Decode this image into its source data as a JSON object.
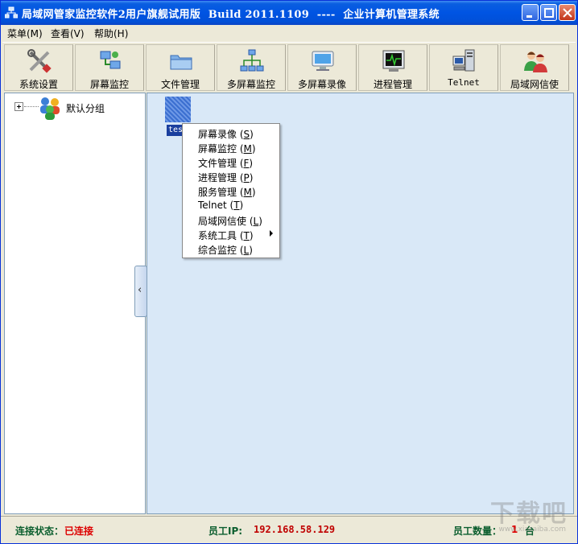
{
  "window": {
    "title": "局域网管家监控软件2用户旗舰试用版  Build 2011.1109  ----  企业计算机管理系统"
  },
  "menubar": {
    "items": [
      "菜单(M)",
      "查看(V)",
      "帮助(H)"
    ]
  },
  "toolbar": {
    "buttons": [
      {
        "label": "系统设置",
        "icon": "tools-icon"
      },
      {
        "label": "屏幕监控",
        "icon": "network-monitor-icon"
      },
      {
        "label": "文件管理",
        "icon": "folder-icon"
      },
      {
        "label": "多屏幕监控",
        "icon": "multi-network-icon"
      },
      {
        "label": "多屏幕录像",
        "icon": "monitor-icon"
      },
      {
        "label": "进程管理",
        "icon": "process-icon"
      },
      {
        "label": "Telnet",
        "icon": "telnet-icon"
      },
      {
        "label": "局域网信使",
        "icon": "users-icon"
      }
    ]
  },
  "tree": {
    "group_label": "默认分组"
  },
  "host": {
    "label": "tes"
  },
  "context_menu": {
    "items": [
      {
        "text": "屏幕录像",
        "acc": "S"
      },
      {
        "text": "屏幕监控",
        "acc": "M"
      },
      {
        "text": "文件管理",
        "acc": "F"
      },
      {
        "text": "进程管理",
        "acc": "P"
      },
      {
        "text": "服务管理",
        "acc": "M"
      },
      {
        "text": "Telnet",
        "acc": "T"
      },
      {
        "text": "局域网信使",
        "acc": "L"
      },
      {
        "text": "系统工具",
        "acc": "T",
        "submenu": true
      },
      {
        "text": "综合监控",
        "acc": "L"
      }
    ]
  },
  "statusbar": {
    "conn_label": "连接状态：",
    "conn_value": "已连接",
    "ip_label": "员工IP:",
    "ip_value": "192.168.58.129",
    "count_label": "员工数量：",
    "count_value": "1",
    "count_unit": "台"
  },
  "watermark": {
    "text": "下载吧",
    "sub": "www.xiazaiba.com"
  },
  "colors": {
    "titlebar": "#0054e3",
    "panel_bg": "#d9e8f7",
    "status_green": "#0b5e2e",
    "status_red": "#dd0000"
  }
}
